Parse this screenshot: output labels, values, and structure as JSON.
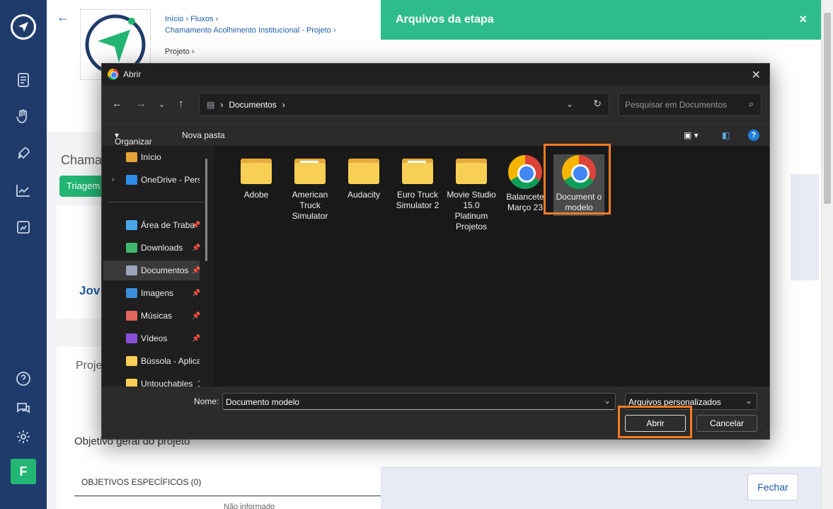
{
  "rail": {
    "avatar_letter": "F"
  },
  "page": {
    "breadcrumb1": "Início",
    "breadcrumb2": "Fluxos",
    "breadcrumb3": "Chamamento Acolhimento Institucional - Projeto",
    "breadcrumb4": "Projeto",
    "chama_title": "Chama",
    "tab_triagem": "Triagem",
    "jov_text": "Jov",
    "proj_text": "Proje",
    "objetivo_label": "Objetivo geral do projeto",
    "objetivos_especificos": "OBJETIVOS ESPECÍFICOS (0)",
    "nao_informado": "Não informado"
  },
  "panel": {
    "title": "Arquivos da etapa",
    "close_glyph": "×",
    "fechar_label": "Fechar"
  },
  "dialog": {
    "title": "Abrir",
    "address_segment": "Documentos",
    "search_placeholder": "Pesquisar em Documentos",
    "organizar": "Organizar",
    "nova_pasta": "Nova pasta",
    "sidebar": [
      {
        "label": "Início",
        "icon": "home-icon",
        "color": "#e8a23a",
        "pinned": false
      },
      {
        "label": "OneDrive - Pers",
        "icon": "onedrive-icon",
        "color": "#2f8ee8",
        "pinned": false
      },
      {
        "label": "Área de Traba",
        "icon": "desktop-icon",
        "color": "#4aa6e8",
        "pinned": true
      },
      {
        "label": "Downloads",
        "icon": "download-icon",
        "color": "#3fb86e",
        "pinned": true
      },
      {
        "label": "Documentos",
        "icon": "documents-icon",
        "color": "#9aa6b8",
        "pinned": true
      },
      {
        "label": "Imagens",
        "icon": "pictures-icon",
        "color": "#3b8ed8",
        "pinned": true
      },
      {
        "label": "Músicas",
        "icon": "music-icon",
        "color": "#e0645a",
        "pinned": true
      },
      {
        "label": "Vídeos",
        "icon": "videos-icon",
        "color": "#8a4fd8",
        "pinned": true
      },
      {
        "label": "Bússola - Aplica",
        "icon": "folder-icon",
        "color": "#f8cf55",
        "pinned": false
      },
      {
        "label": "Untouchables_1",
        "icon": "folder-icon",
        "color": "#f8cf55",
        "pinned": false
      }
    ],
    "files": [
      {
        "name": "Adobe",
        "type": "folder"
      },
      {
        "name": "American Truck Simulator",
        "type": "folder-doc"
      },
      {
        "name": "Audacity",
        "type": "folder"
      },
      {
        "name": "Euro Truck Simulator 2",
        "type": "folder-doc"
      },
      {
        "name": "Movie Studio 15.0 Platinum Projetos",
        "type": "folder"
      },
      {
        "name": "Balancete Março 23",
        "type": "chrome"
      },
      {
        "name": "Document o modelo",
        "type": "chrome"
      }
    ],
    "nome_label": "Nome:",
    "nome_value": "Documento modelo",
    "filetype": "Arquivos personalizados",
    "abrir_label": "Abrir",
    "cancelar_label": "Cancelar"
  }
}
